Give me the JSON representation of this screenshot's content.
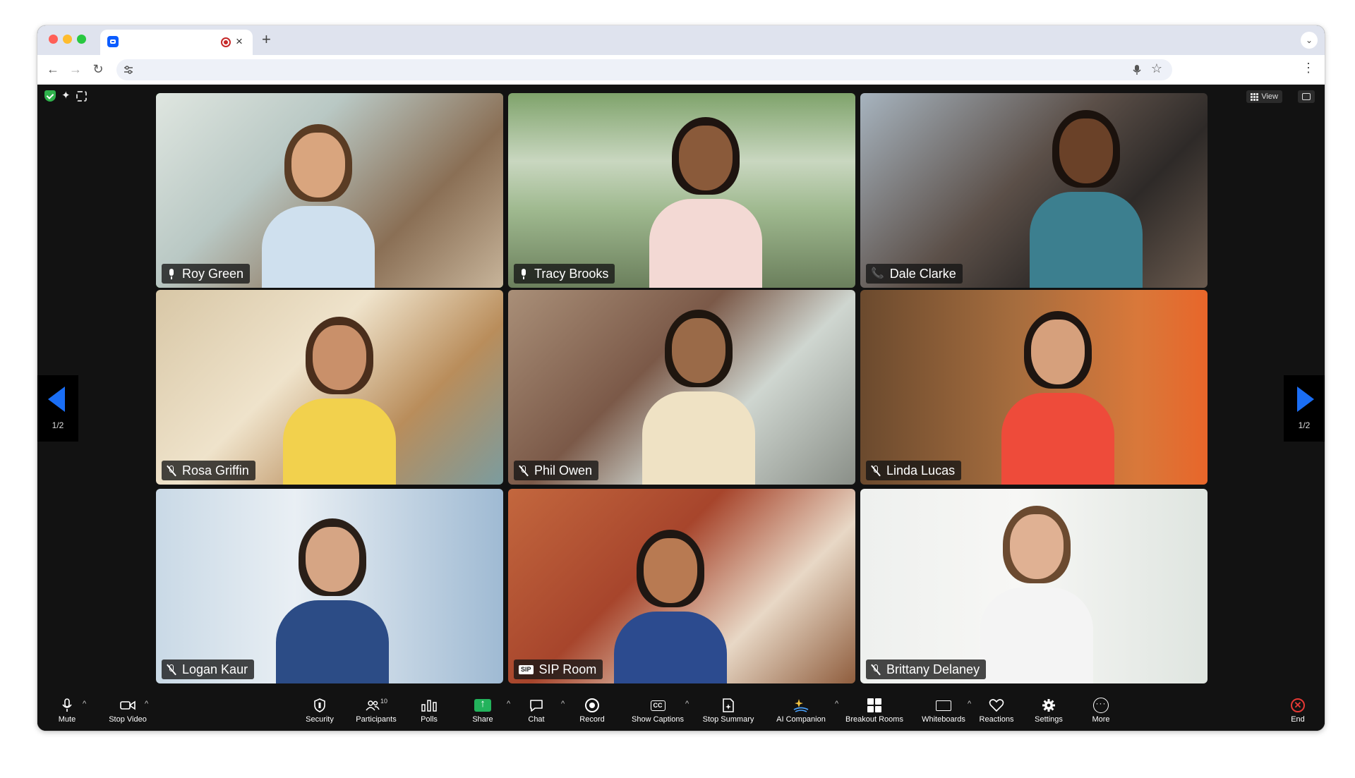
{
  "browser": {
    "tab_close": "×",
    "new_tab": "+",
    "tab_menu": "⌄",
    "nav": {
      "back": "←",
      "forward": "→",
      "reload": "↻"
    },
    "kebab": "⋮"
  },
  "meeting": {
    "view_label": "View",
    "pager": {
      "left": "1/2",
      "right": "1/2"
    },
    "tiles": [
      {
        "name": "Roy Green",
        "audio": "mic-on",
        "active": true
      },
      {
        "name": "Tracy Brooks",
        "audio": "mic-on",
        "active": false
      },
      {
        "name": "Dale Clarke",
        "audio": "phone",
        "active": false
      },
      {
        "name": "Rosa Griffin",
        "audio": "mic-off",
        "active": false
      },
      {
        "name": "Phil Owen",
        "audio": "mic-off",
        "active": false
      },
      {
        "name": "Linda Lucas",
        "audio": "mic-off",
        "active": false
      },
      {
        "name": "Logan Kaur",
        "audio": "mic-off",
        "active": false
      },
      {
        "name": "SIP Room",
        "audio": "sip",
        "active": false
      },
      {
        "name": "Brittany Delaney",
        "audio": "mic-off",
        "active": false
      }
    ],
    "sip_badge": "SIP"
  },
  "controls": {
    "mute": "Mute",
    "stop_video": "Stop Video",
    "security": "Security",
    "participants": "Participants",
    "participants_count": "10",
    "polls": "Polls",
    "share": "Share",
    "chat": "Chat",
    "record": "Record",
    "show_captions": "Show Captions",
    "stop_summary": "Stop Summary",
    "ai_companion": "AI Companion",
    "breakout_rooms": "Breakout Rooms",
    "whiteboards": "Whiteboards",
    "reactions": "Reactions",
    "settings": "Settings",
    "more": "More",
    "end": "End",
    "cc": "CC"
  },
  "colors": {
    "accent_blue": "#1a6ef5",
    "active_speaker": "#3ccf4e",
    "share_green": "#23b35c",
    "end_red": "#e53935"
  }
}
